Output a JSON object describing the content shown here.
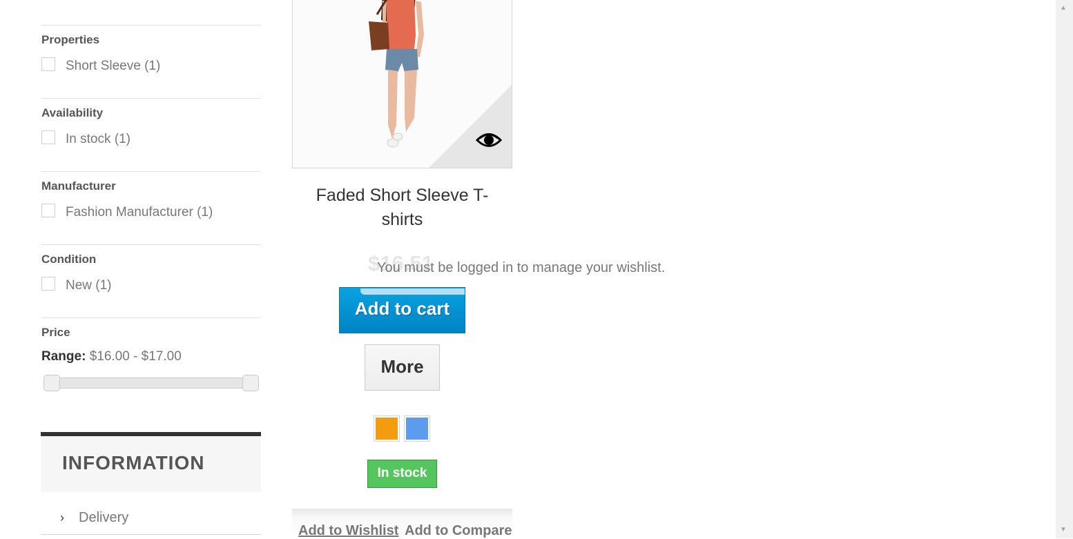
{
  "sidebar": {
    "filters": [
      {
        "title": "Properties",
        "option": "Short Sleeve (1)"
      },
      {
        "title": "Availability",
        "option": "In stock (1)"
      },
      {
        "title": "Manufacturer",
        "option": "Fashion Manufacturer (1)"
      },
      {
        "title": "Condition",
        "option": "New (1)"
      }
    ],
    "price": {
      "title": "Price",
      "range_label": "Range:",
      "range_value": "$16.00 - $17.00",
      "min": 16.0,
      "max": 17.0
    },
    "information": {
      "title": "INFORMATION",
      "items": [
        "Delivery"
      ]
    }
  },
  "product": {
    "name": "Faded Short Sleeve T-shirts",
    "price": "$16.51",
    "wishlist_message": "You must be logged in to manage your wishlist.",
    "add_to_cart": "Add to cart",
    "more": "More",
    "colors": [
      "#f39c11",
      "#5d9cec"
    ],
    "availability": "In stock",
    "add_to_wishlist": "Add to Wishlist",
    "add_to_compare": "Add to Compare"
  },
  "colors": {
    "accent_blue": "#0090d0",
    "stock_green": "#55c65e"
  }
}
